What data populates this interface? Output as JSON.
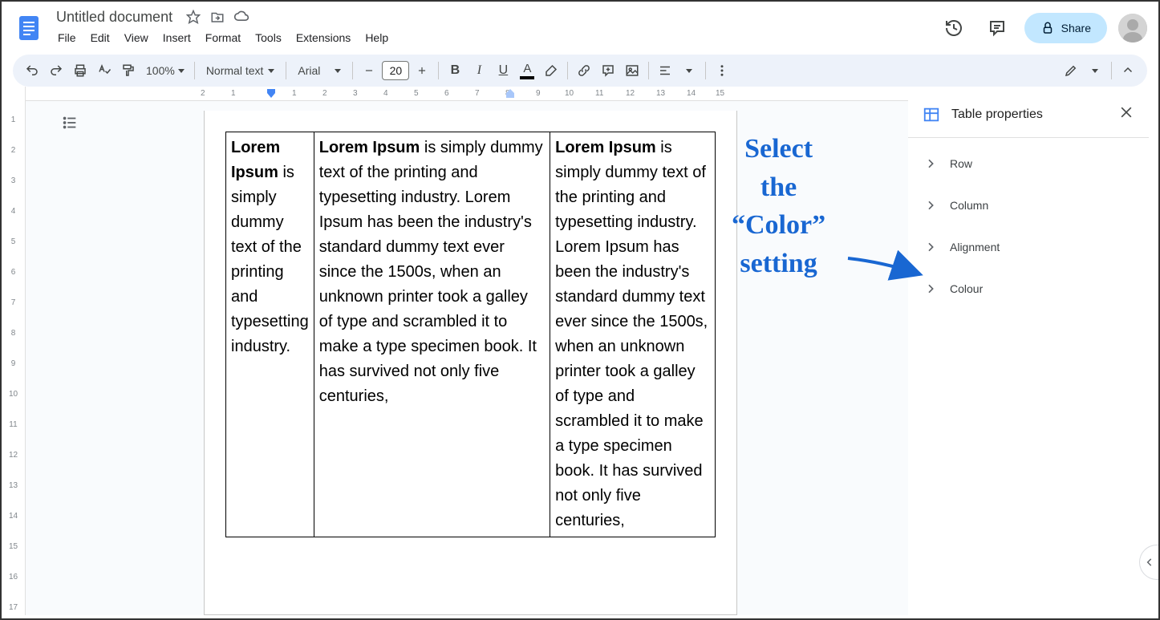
{
  "header": {
    "title": "Untitled document",
    "menus": [
      "File",
      "Edit",
      "View",
      "Insert",
      "Format",
      "Tools",
      "Extensions",
      "Help"
    ],
    "share": "Share"
  },
  "toolbar": {
    "zoom": "100%",
    "style": "Normal text",
    "font": "Arial",
    "size": "20"
  },
  "ruler_h": [
    "2",
    "1",
    "",
    "1",
    "2",
    "3",
    "4",
    "5",
    "6",
    "7",
    "8",
    "9",
    "10",
    "11",
    "12",
    "13",
    "14",
    "15"
  ],
  "ruler_v": [
    "1",
    "2",
    "3",
    "4",
    "5",
    "6",
    "7",
    "8",
    "9",
    "10",
    "11",
    "12",
    "13",
    "14",
    "15",
    "16",
    "17"
  ],
  "table": {
    "cells": [
      {
        "bold": "Lorem Ipsum",
        "rest": " is simply dummy text of the printing and typesetting industry."
      },
      {
        "bold": "Lorem Ipsum",
        "rest": " is simply dummy text of the printing and typesetting industry. Lorem Ipsum has been the industry's standard dummy text ever since the 1500s, when an unknown printer took a galley of type and scrambled it to make a type specimen book. It has survived not only five centuries,"
      },
      {
        "bold": "Lorem Ipsum",
        "rest": " is simply dummy text of the printing and typesetting industry. Lorem Ipsum has been the industry's standard dummy text ever since the 1500s, when an unknown printer took a galley of type and scrambled it to make a type specimen book. It has survived not only five centuries,"
      }
    ]
  },
  "sidebar": {
    "title": "Table properties",
    "items": [
      "Row",
      "Column",
      "Alignment",
      "Colour"
    ]
  },
  "annotation": {
    "line1": "Select",
    "line2": "the",
    "line3": "“Color”",
    "line4": "setting"
  }
}
